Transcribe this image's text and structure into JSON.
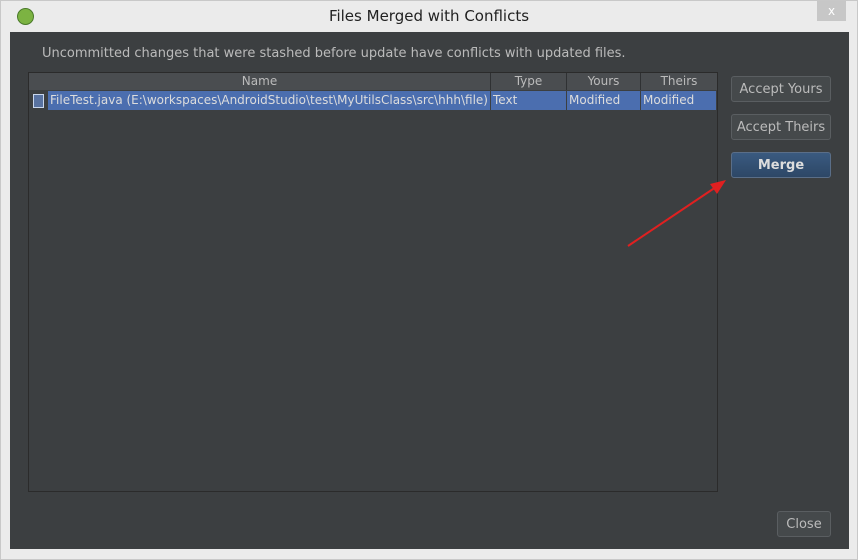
{
  "window": {
    "title": "Files Merged with Conflicts",
    "close_glyph": "x"
  },
  "message": "Uncommitted changes that were stashed before update have conflicts with updated files.",
  "table": {
    "columns": [
      "Name",
      "Type",
      "Yours",
      "Theirs"
    ],
    "rows": [
      {
        "name": "FileTest.java (E:\\workspaces\\AndroidStudio\\test\\MyUtilsClass\\src\\hhh\\file)",
        "type": "Text",
        "yours": "Modified",
        "theirs": "Modified",
        "icon": "java-file-icon"
      }
    ]
  },
  "buttons": {
    "accept_yours": "Accept Yours",
    "accept_theirs": "Accept Theirs",
    "merge": "Merge",
    "close": "Close"
  },
  "colors": {
    "selection": "#4b6eaf",
    "annotation_arrow": "#e02020"
  }
}
